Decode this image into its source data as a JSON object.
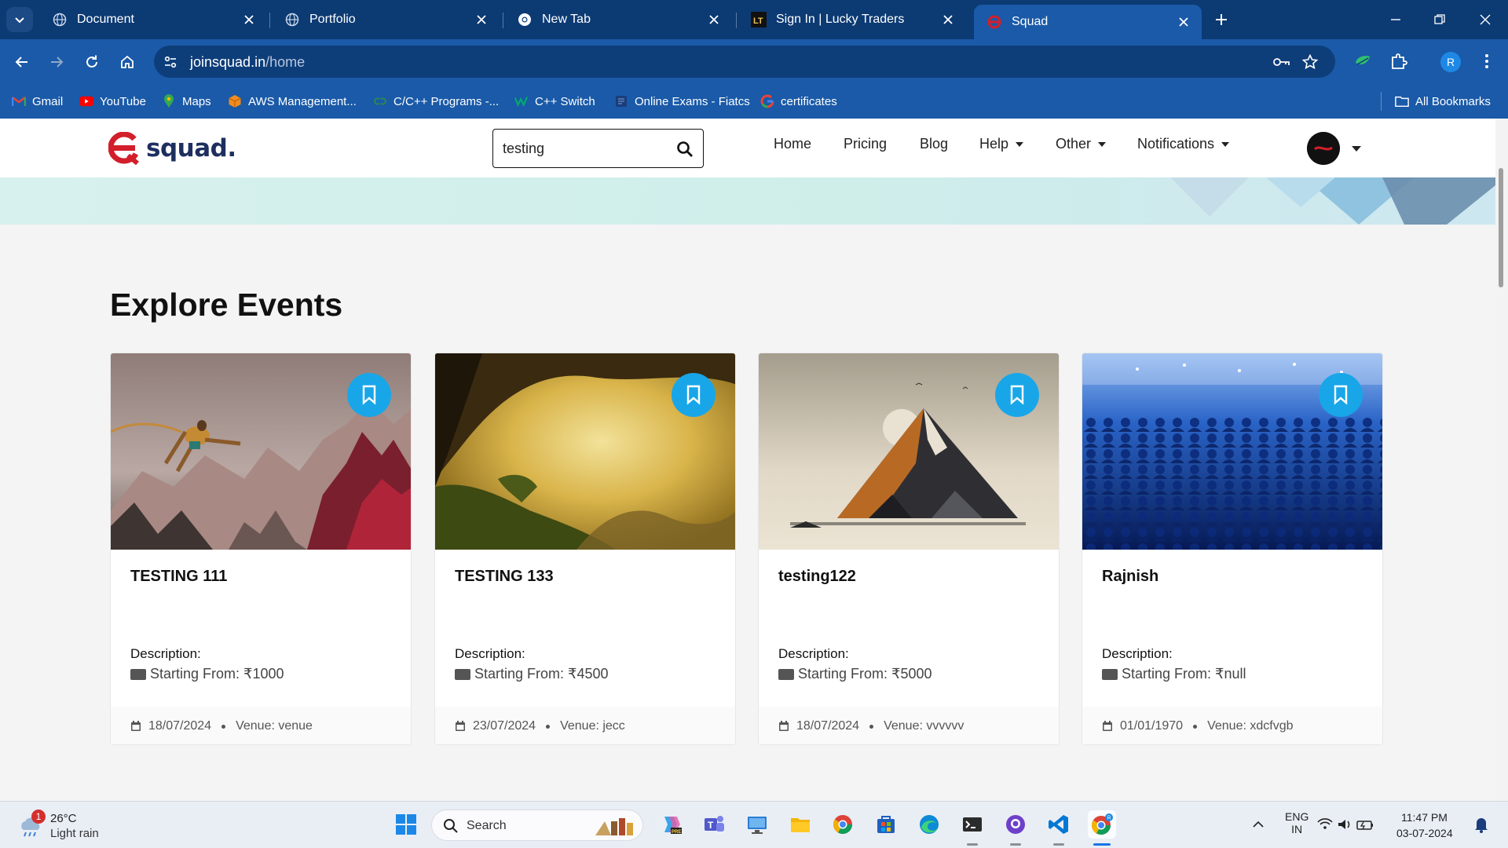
{
  "browser": {
    "tabs": [
      {
        "title": "Document",
        "icon": "globe-icon"
      },
      {
        "title": "Portfolio",
        "icon": "globe-icon"
      },
      {
        "title": "New Tab",
        "icon": "chrome-icon"
      },
      {
        "title": "Sign In | Lucky Traders",
        "icon": "lt-icon"
      },
      {
        "title": "Squad",
        "icon": "squad-icon",
        "active": true
      }
    ],
    "url_host": "joinsquad.in",
    "url_path": "/home",
    "profile_initial": "R",
    "bookmarks": [
      {
        "label": "Gmail",
        "icon": "gmail-icon"
      },
      {
        "label": "YouTube",
        "icon": "youtube-icon"
      },
      {
        "label": "Maps",
        "icon": "maps-icon"
      },
      {
        "label": "AWS Management...",
        "icon": "aws-icon"
      },
      {
        "label": "C/C++ Programs -...",
        "icon": "geeks-icon"
      },
      {
        "label": "C++ Switch",
        "icon": "w3-icon"
      },
      {
        "label": "Online Exams - Fiatcs",
        "icon": "exam-icon"
      },
      {
        "label": "certificates",
        "icon": "google-icon"
      }
    ],
    "all_bookmarks": "All Bookmarks"
  },
  "site": {
    "logo_text": "squad.",
    "search_value": "testing",
    "nav": [
      {
        "label": "Home",
        "dropdown": false
      },
      {
        "label": "Pricing",
        "dropdown": false
      },
      {
        "label": "Blog",
        "dropdown": false
      },
      {
        "label": "Help",
        "dropdown": true
      },
      {
        "label": "Other",
        "dropdown": true
      },
      {
        "label": "Notifications",
        "dropdown": true
      }
    ],
    "accent": "#18a6e8",
    "brand_red": "#d21f2b",
    "brand_navy": "#1d2f5f"
  },
  "main": {
    "section_title": "Explore Events",
    "desc_label": "Description:",
    "events": [
      {
        "title": "TESTING 111",
        "price": "Starting From: ₹1000",
        "date": "18/07/2024",
        "venue": "Venue: venue"
      },
      {
        "title": "TESTING 133",
        "price": "Starting From: ₹4500",
        "date": "23/07/2024",
        "venue": "Venue: jecc"
      },
      {
        "title": "testing122",
        "price": "Starting From: ₹5000",
        "date": "18/07/2024",
        "venue": "Venue: vvvvvv"
      },
      {
        "title": "Rajnish",
        "price": "Starting From: ₹null",
        "date": "01/01/1970",
        "venue": "Venue: xdcfvgb"
      }
    ]
  },
  "taskbar": {
    "weather_temp": "26°C",
    "weather_desc": "Light rain",
    "weather_badge": "1",
    "search_placeholder": "Search",
    "lang_top": "ENG",
    "lang_bottom": "IN",
    "time": "11:47 PM",
    "date": "03-07-2024"
  }
}
